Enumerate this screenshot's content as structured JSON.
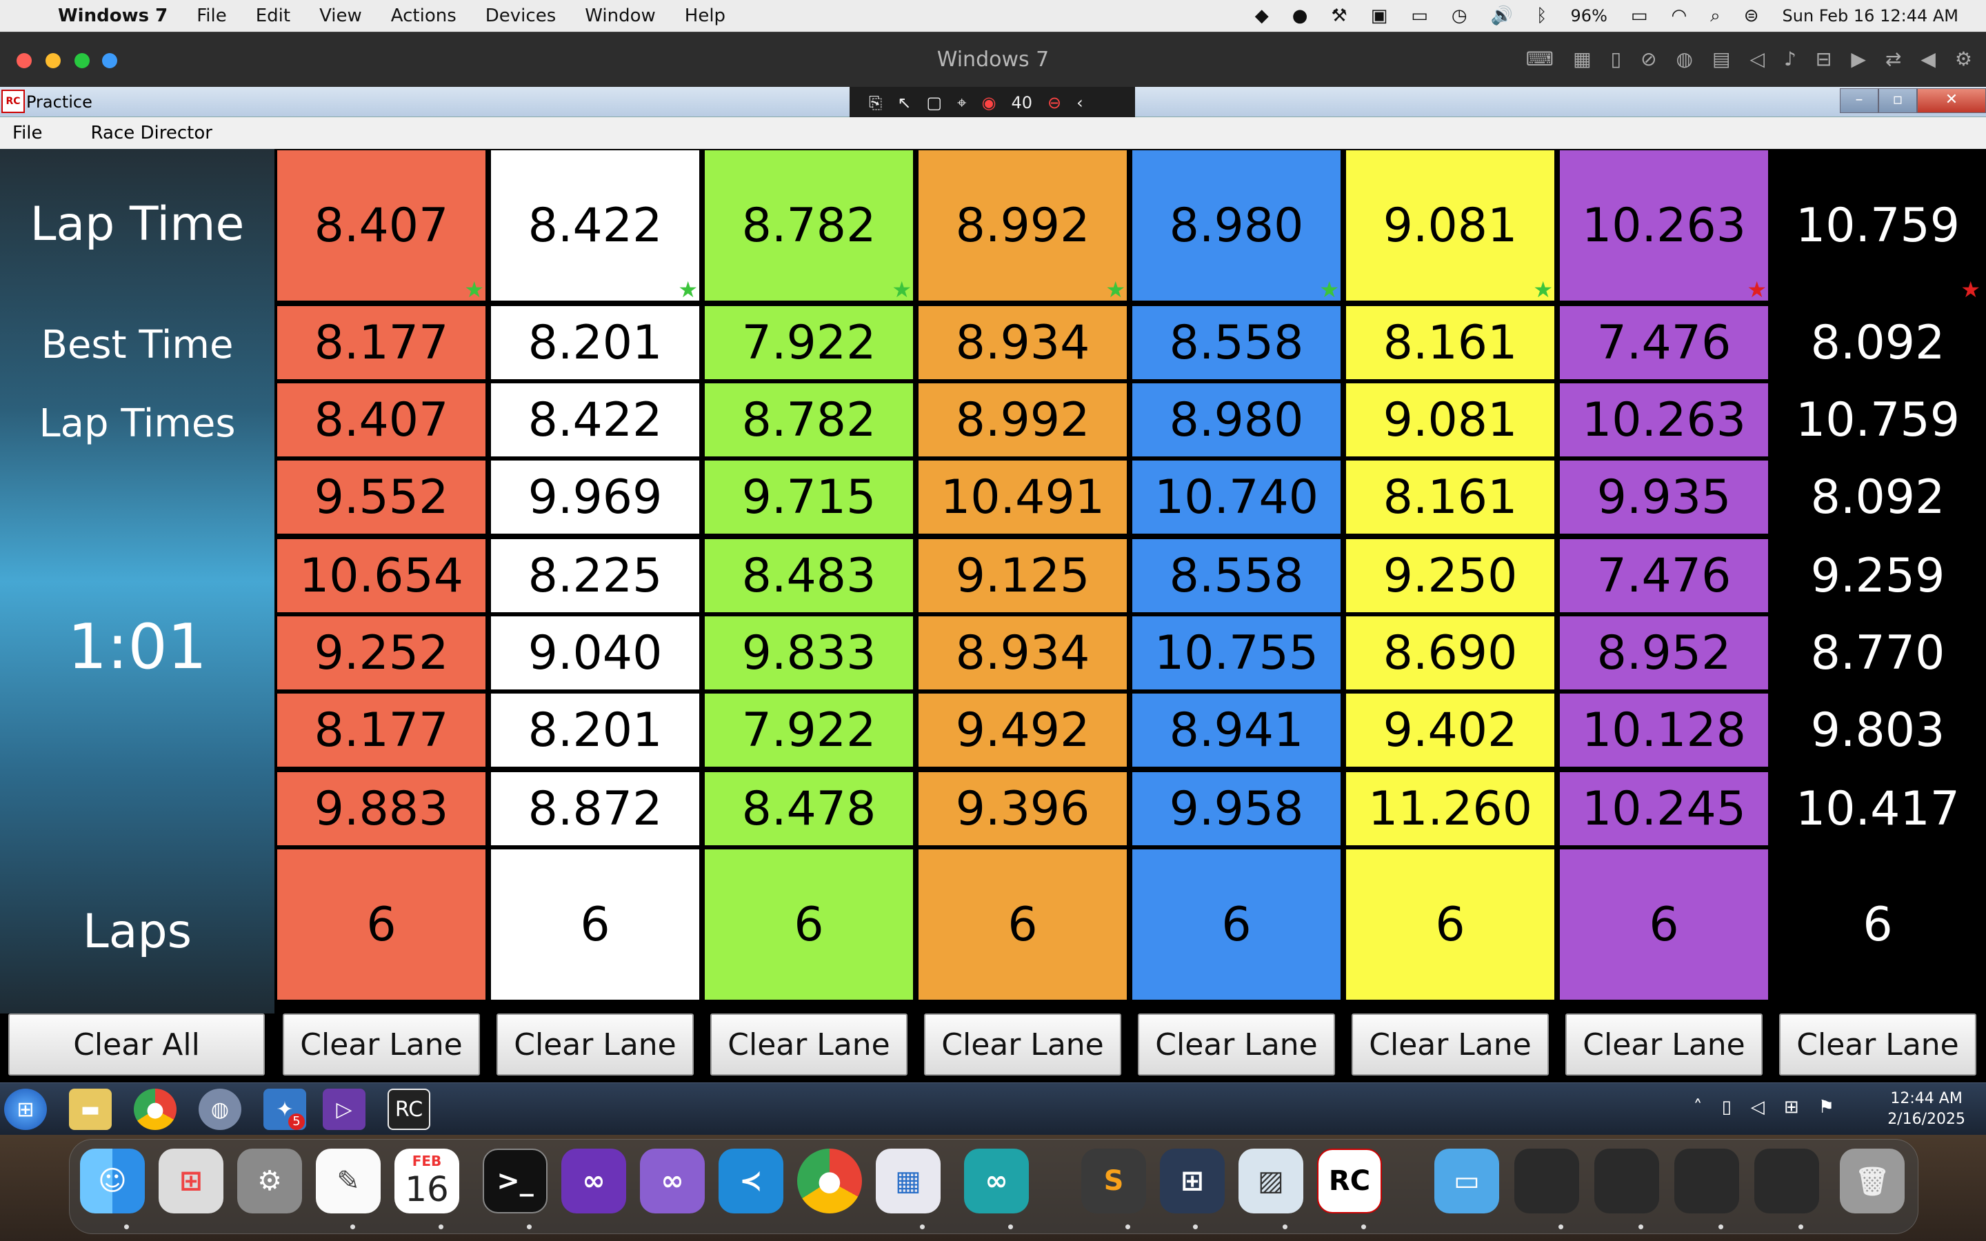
{
  "menubar": {
    "app": "Windows 7",
    "items": [
      "File",
      "Edit",
      "View",
      "Actions",
      "Devices",
      "Window",
      "Help"
    ],
    "battery": "96%",
    "clock": "Sun Feb 16  12:44 AM"
  },
  "vm": {
    "title": "Windows 7",
    "fps": "40"
  },
  "app": {
    "title": "Practice",
    "menu": [
      "File",
      "Race Director"
    ],
    "icon_text": "RC"
  },
  "labels": {
    "lap_time": "Lap Time",
    "best_time": "Best Time",
    "lap_times": "Lap Times",
    "clock": "1:01",
    "laps": "Laps"
  },
  "lanes": [
    {
      "color": "#ef6b4f",
      "text": "dark-on-light",
      "lap": "8.407",
      "best": "8.177",
      "laps_list": [
        "8.407",
        "9.552",
        "10.654",
        "9.252",
        "8.177",
        "9.883"
      ],
      "laps": "6",
      "star_color": "#3cc43c"
    },
    {
      "color": "#ffffff",
      "text": "dark-on-light",
      "lap": "8.422",
      "best": "8.201",
      "laps_list": [
        "8.422",
        "9.969",
        "8.225",
        "9.040",
        "8.201",
        "8.872"
      ],
      "laps": "6",
      "star_color": "#3cc43c"
    },
    {
      "color": "#9df24a",
      "text": "dark-on-light",
      "lap": "8.782",
      "best": "7.922",
      "laps_list": [
        "8.782",
        "9.715",
        "8.483",
        "9.833",
        "7.922",
        "8.478"
      ],
      "laps": "6",
      "star_color": "#3cc43c"
    },
    {
      "color": "#f0a33a",
      "text": "dark-on-light",
      "lap": "8.992",
      "best": "8.934",
      "laps_list": [
        "8.992",
        "10.491",
        "9.125",
        "8.934",
        "9.492",
        "9.396"
      ],
      "laps": "6",
      "star_color": "#3cc43c"
    },
    {
      "color": "#3f8ef0",
      "text": "dark-on-light",
      "lap": "8.980",
      "best": "8.558",
      "laps_list": [
        "8.980",
        "10.740",
        "8.558",
        "10.755",
        "8.941",
        "9.958"
      ],
      "laps": "6",
      "star_color": "#3cc43c"
    },
    {
      "color": "#fbfb47",
      "text": "dark-on-light",
      "lap": "9.081",
      "best": "8.161",
      "laps_list": [
        "9.081",
        "8.161",
        "9.250",
        "8.690",
        "9.402",
        "11.260"
      ],
      "laps": "6",
      "star_color": "#3cc43c"
    },
    {
      "color": "#a855d2",
      "text": "dark-on-light",
      "lap": "10.263",
      "best": "7.476",
      "laps_list": [
        "10.263",
        "9.935",
        "7.476",
        "8.952",
        "10.128",
        "10.245"
      ],
      "laps": "6",
      "star_color": "#e02020"
    },
    {
      "color": "#000000",
      "text": "light-on-dark",
      "lap": "10.759",
      "best": "8.092",
      "laps_list": [
        "10.759",
        "8.092",
        "9.259",
        "8.770",
        "9.803",
        "10.417"
      ],
      "laps": "6",
      "star_color": "#e02020"
    }
  ],
  "buttons": {
    "clear_all": "Clear All",
    "clear_lane": "Clear Lane"
  },
  "win_tray": {
    "time": "12:44 AM",
    "date": "2/16/2025"
  },
  "win_taskbar_badge": "5",
  "dock": {
    "calendar_month": "FEB",
    "calendar_day": "16"
  }
}
